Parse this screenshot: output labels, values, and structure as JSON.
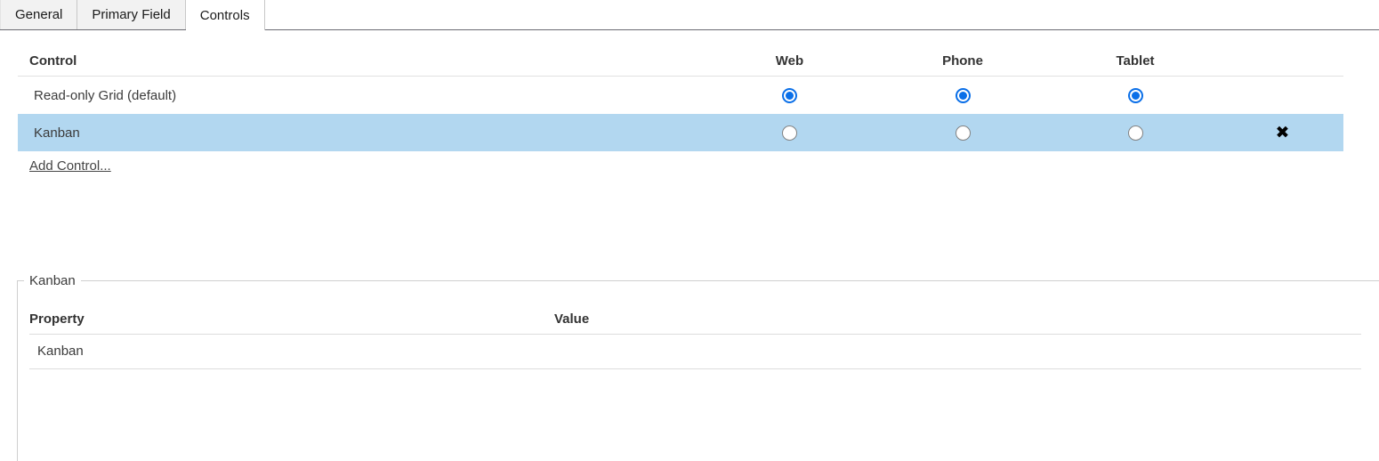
{
  "tabs": [
    {
      "label": "General",
      "active": false
    },
    {
      "label": "Primary Field",
      "active": false
    },
    {
      "label": "Controls",
      "active": true
    }
  ],
  "controls": {
    "headers": {
      "control": "Control",
      "web": "Web",
      "phone": "Phone",
      "tablet": "Tablet"
    },
    "rows": [
      {
        "name": "Read-only Grid (default)",
        "web": "checked",
        "phone": "checked",
        "tablet": "checked",
        "selected": false,
        "deletable": false,
        "delete_glyph": ""
      },
      {
        "name": "Kanban",
        "web": "unchecked",
        "phone": "unchecked",
        "tablet": "unchecked",
        "selected": true,
        "deletable": true,
        "delete_glyph": "✖"
      }
    ],
    "add_control_label": "Add Control..."
  },
  "properties": {
    "legend": "Kanban",
    "headers": {
      "property": "Property",
      "value": "Value"
    },
    "rows": [
      {
        "property": "Kanban",
        "value": ""
      }
    ]
  },
  "colors": {
    "row_selected": "#b2d7f0",
    "radio_accent": "#0a6fe8",
    "tab_inactive_bg": "#f2f2f2",
    "tab_active_bg": "#ffffff",
    "border": "#cfcfcf"
  }
}
